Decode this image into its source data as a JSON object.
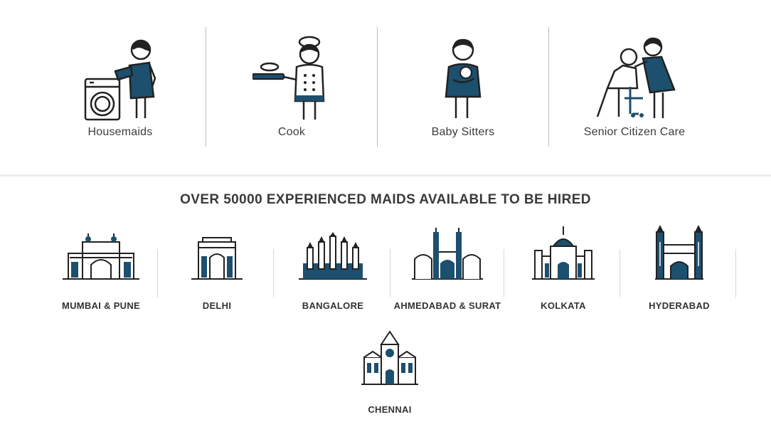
{
  "services": [
    {
      "label": "Housemaids",
      "icon": "housemaid-icon"
    },
    {
      "label": "Cook",
      "icon": "cook-icon"
    },
    {
      "label": "Baby Sitters",
      "icon": "baby-sitter-icon"
    },
    {
      "label": "Senior Citizen Care",
      "icon": "senior-care-icon"
    }
  ],
  "cities_heading": "OVER 50000 EXPERIENCED MAIDS AVAILABLE TO BE HIRED",
  "cities": [
    {
      "label": "MUMBAI & PUNE",
      "icon": "gateway-of-india-icon"
    },
    {
      "label": "DELHI",
      "icon": "india-gate-icon"
    },
    {
      "label": "BANGALORE",
      "icon": "vidhana-soudha-icon"
    },
    {
      "label": "AHMEDABAD & SURAT",
      "icon": "mosque-icon"
    },
    {
      "label": "KOLKATA",
      "icon": "victoria-memorial-icon"
    },
    {
      "label": "HYDERABAD",
      "icon": "charminar-icon"
    },
    {
      "label": "CHENNAI",
      "icon": "central-station-icon"
    }
  ],
  "colors": {
    "accent": "#1d4f6e",
    "line": "#222222"
  }
}
